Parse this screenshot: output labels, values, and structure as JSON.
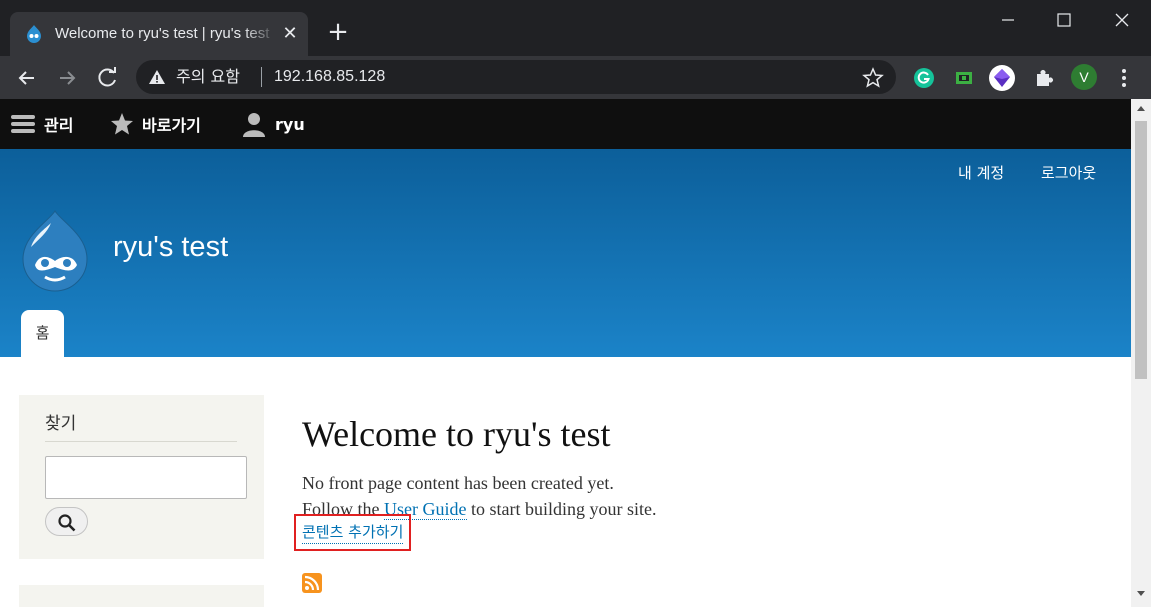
{
  "browser": {
    "tab_title": "Welcome to ryu's test | ryu's test",
    "tab_close_glyph": "✕",
    "new_tab_glyph": "+",
    "security_label": "주의 요함",
    "url": "192.168.85.128",
    "profile_initial": "V"
  },
  "admin_toolbar": {
    "manage": "관리",
    "shortcuts": "바로가기",
    "user": "ryu"
  },
  "header": {
    "secondary_menu": [
      "내 계정",
      "로그아웃"
    ],
    "site_name": "ryu's test",
    "main_menu": [
      "홈"
    ]
  },
  "sidebar": {
    "search_title": "찾기",
    "search_value": ""
  },
  "main": {
    "title": "Welcome to ryu's test",
    "line1": "No front page content has been created yet.",
    "line2_before": "Follow the ",
    "line2_link": "User Guide",
    "line2_after": " to start building your site.",
    "add_content_link": "콘텐츠 추가하기"
  },
  "colors": {
    "header_top": "#0c5f9a",
    "header_bottom": "#1b83c8",
    "link": "#0071b3",
    "highlight": "#e02020",
    "admin_bar": "#0f0f0f"
  },
  "icons": [
    "drupal-favicon-icon",
    "warning-icon",
    "star-icon",
    "grammarly-icon",
    "extension-icon",
    "puzzle-icon",
    "hamburger-icon",
    "shortcut-star-icon",
    "user-icon",
    "drupal-logo",
    "search-icon",
    "rss-icon"
  ]
}
